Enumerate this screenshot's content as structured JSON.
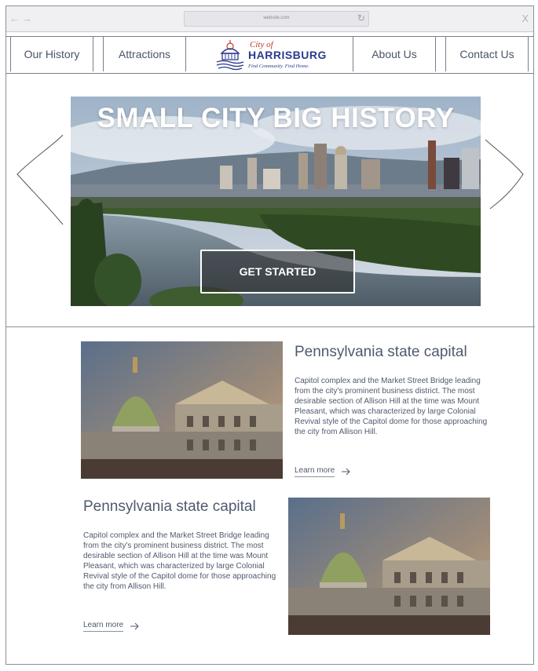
{
  "browser": {
    "url": "website.com",
    "back_icon": "arrow-left",
    "forward_icon": "arrow-right",
    "reload_icon": "reload",
    "close_icon": "close"
  },
  "nav": {
    "items": [
      {
        "label": "Our History"
      },
      {
        "label": "Attractions"
      },
      {
        "label": "About Us"
      },
      {
        "label": "Contact Us"
      }
    ],
    "logo": {
      "city_of": "City of",
      "name": "HARRISBURG",
      "tagline": "Find Community. Find Home."
    }
  },
  "hero": {
    "title": "SMALL CITY BIG HISTORY",
    "button": "GET STARTED"
  },
  "cards": [
    {
      "title": "Pennsylvania state capital",
      "body": "Capitol complex and the Market Street Bridge leading from the city's prominent business district. The most desirable section of Allison Hill at the time was Mount Pleasant, which was characterized by large Colonial Revival style  of the Capitol dome for those approaching the city from Allison Hill.",
      "link": "Learn more"
    },
    {
      "title": "Pennsylvania state capital",
      "body": "Capitol complex and the Market Street Bridge leading from the city's prominent business district. The most desirable section of Allison Hill at the time was Mount Pleasant, which was characterized by large Colonial Revival style  of the Capitol dome for those approaching the city from Allison Hill.",
      "link": "Learn more"
    }
  ],
  "colors": {
    "nav_text": "#4a5468",
    "logo_blue": "#2c3a8c",
    "logo_red": "#c0392b",
    "border": "#7a7e8c"
  }
}
